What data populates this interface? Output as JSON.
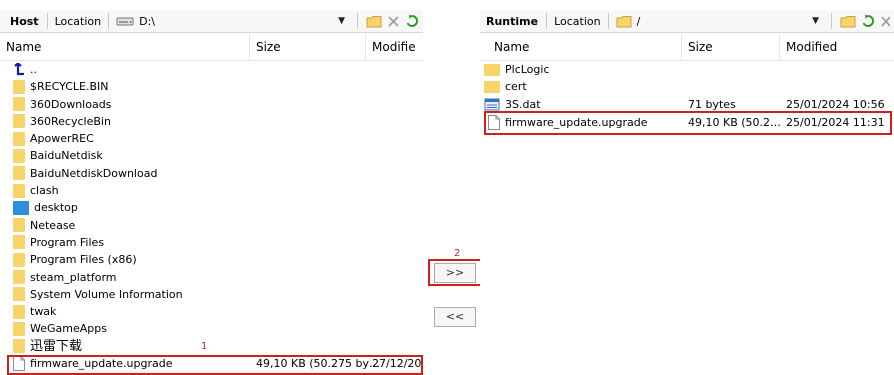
{
  "host": {
    "title": "Host",
    "location_label": "Location",
    "path": "D:\\",
    "columns": {
      "name": "Name",
      "size": "Size",
      "modified": "Modifie"
    },
    "rows": [
      {
        "name": "..",
        "size": "",
        "modified": ""
      },
      {
        "name": "$RECYCLE.BIN",
        "size": "",
        "modified": ""
      },
      {
        "name": "360Downloads",
        "size": "",
        "modified": ""
      },
      {
        "name": "360RecycleBin",
        "size": "",
        "modified": ""
      },
      {
        "name": "ApowerREC",
        "size": "",
        "modified": ""
      },
      {
        "name": "BaiduNetdisk",
        "size": "",
        "modified": ""
      },
      {
        "name": "BaiduNetdiskDownload",
        "size": "",
        "modified": ""
      },
      {
        "name": "clash",
        "size": "",
        "modified": ""
      },
      {
        "name": "desktop",
        "size": "",
        "modified": ""
      },
      {
        "name": "Netease",
        "size": "",
        "modified": ""
      },
      {
        "name": "Program Files",
        "size": "",
        "modified": ""
      },
      {
        "name": "Program Files (x86)",
        "size": "",
        "modified": ""
      },
      {
        "name": "steam_platform",
        "size": "",
        "modified": ""
      },
      {
        "name": "System Volume Information",
        "size": "",
        "modified": ""
      },
      {
        "name": "twak",
        "size": "",
        "modified": ""
      },
      {
        "name": "WeGameApps",
        "size": "",
        "modified": ""
      },
      {
        "name": "迅雷下载",
        "size": "",
        "modified": ""
      },
      {
        "name": "firmware_update.upgrade",
        "size": "49,10 KB (50.275 by…",
        "modified": "27/12/20"
      }
    ]
  },
  "runtime": {
    "title": "Runtime",
    "location_label": "Location",
    "path": "/",
    "columns": {
      "name": "Name",
      "size": "Size",
      "modified": "Modified"
    },
    "rows": [
      {
        "name": "PlcLogic",
        "size": "",
        "modified": ""
      },
      {
        "name": "cert",
        "size": "",
        "modified": ""
      },
      {
        "name": "3S.dat",
        "size": "71 bytes",
        "modified": "25/01/2024 10:56"
      },
      {
        "name": "firmware_update.upgrade",
        "size": "49,10 KB (50.2…",
        "modified": "25/01/2024 11:31"
      }
    ]
  },
  "transfer": {
    "to_runtime_label": ">>",
    "to_host_label": "<<"
  },
  "annotations": {
    "marker_1": "1",
    "marker_2": "2"
  },
  "icons": {
    "host_drive": "drive-icon",
    "up": "up-arrow-icon",
    "folder": "folder-icon",
    "desktop": "desktop-icon",
    "file": "file-icon",
    "dat_file": "dat-file-icon",
    "new_folder": "new-folder-icon",
    "delete": "delete-icon",
    "refresh": "refresh-icon"
  },
  "colors": {
    "highlight": "#d11f1f",
    "folder": "#f9d46a",
    "refresh": "#2a9d2a"
  }
}
